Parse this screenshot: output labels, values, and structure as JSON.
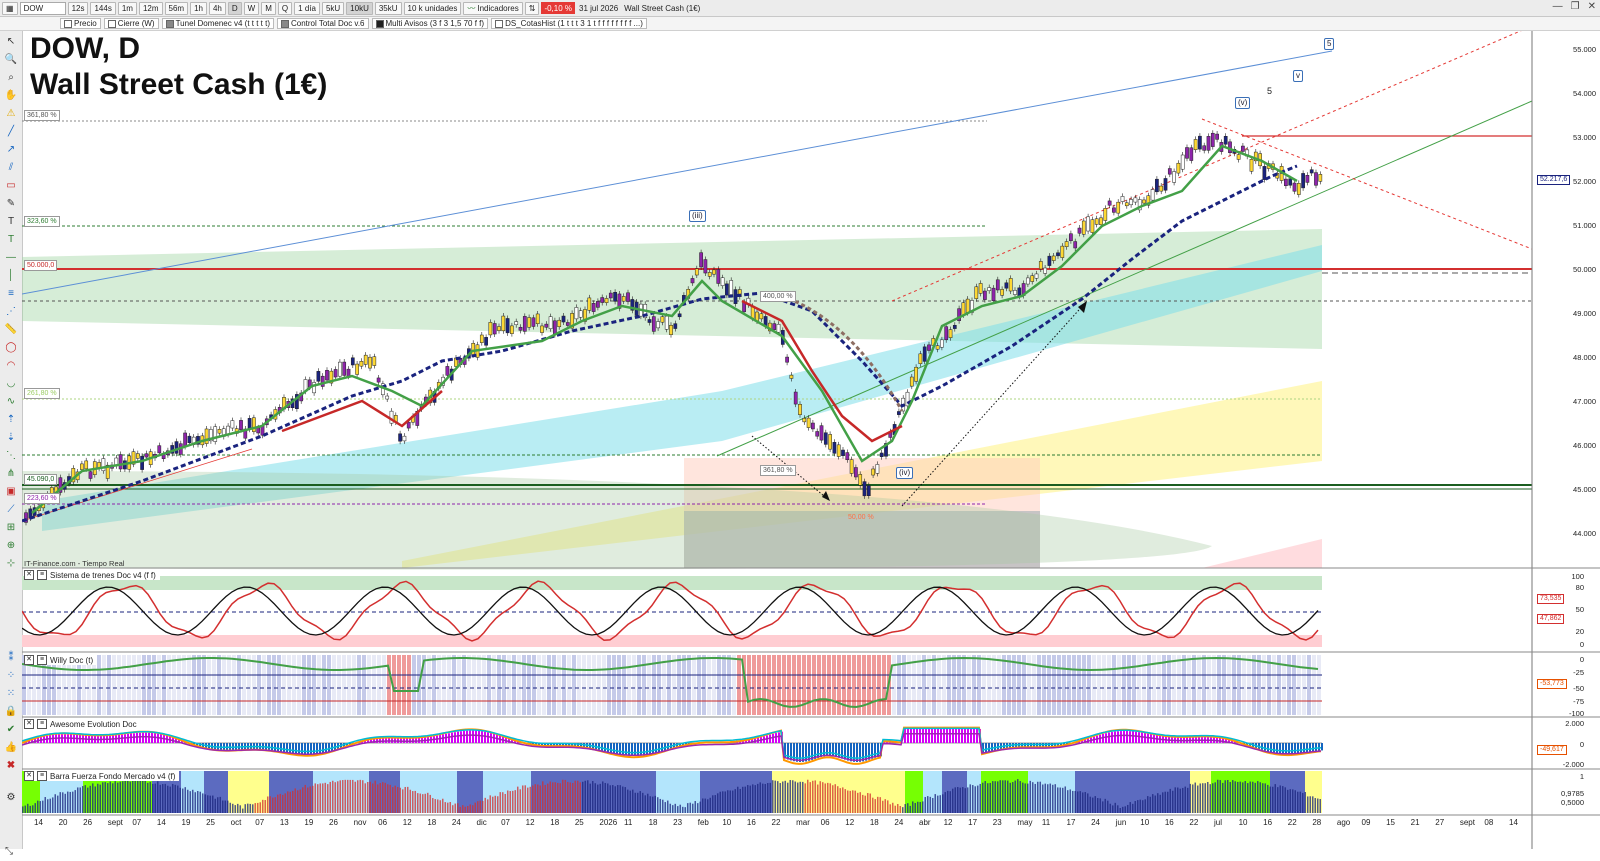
{
  "toolbar": {
    "symbol": "DOW",
    "intervals": [
      "12s",
      "144s",
      "1m",
      "12m",
      "56m",
      "1h",
      "4h",
      "D",
      "W",
      "M",
      "Q"
    ],
    "active_interval": "D",
    "period": "1 día",
    "units": [
      "5kU",
      "10kU",
      "35kU"
    ],
    "active_unit": "10kU",
    "units_select": "10 k unidades",
    "indicators_label": "Indicadores",
    "change_pct": "-0,10 %",
    "date_text": "31 jul 2026",
    "instrument_name": "Wall Street Cash (1€)"
  },
  "indicator_tabs": [
    "Precio",
    "Cierre (W)",
    "Tunel Domenec v4 (t t t t t)",
    "Control Total Doc v.6",
    "Multi Avisos (3 f 3 1,5 70 f f)",
    "DS_CotasHist (1 t t t 3 1 t f f f f f f f f ...)"
  ],
  "chart": {
    "title_line1": "DOW, D",
    "title_line2": "Wall Street Cash (1€)",
    "source": "IT-Finance.com - Tiempo Real",
    "price_axis": [
      "55.000",
      "54.000",
      "53.000",
      "52.000",
      "51.000",
      "50.000",
      "49.000",
      "48.000",
      "47.000",
      "46.000",
      "45.000",
      "44.000"
    ],
    "current_price": "52.217,6",
    "level_tags": [
      "361,80 %",
      "323,60 %",
      "50.000,0",
      "261,80 %",
      "45.090,0",
      "223,60 %"
    ],
    "fib_inner": [
      "400,00 %",
      "361,80 %",
      "50,00 %"
    ],
    "wave_labels": [
      "(iii)",
      "(iv)",
      "(v)",
      "5",
      "v",
      "5"
    ]
  },
  "panes": [
    {
      "name": "Sistema de trenes Doc v4 (f f)",
      "axis": [
        "100",
        "80",
        "50",
        "20",
        "0"
      ],
      "tags": [
        "73,535",
        "47,862"
      ]
    },
    {
      "name": "Willy Doc (t)",
      "axis": [
        "0",
        "-25",
        "-50",
        "-75",
        "-100"
      ],
      "tags": [
        "-53,773"
      ]
    },
    {
      "name": "Awesome Evolution Doc",
      "axis": [
        "2.000",
        "0",
        "-2.000"
      ],
      "tags": [
        "-49,617"
      ]
    },
    {
      "name": "Barra Fuerza Fondo Mercado v4 (f)",
      "axis": [
        "1",
        "0,9785",
        "0,5000"
      ],
      "tags": []
    }
  ],
  "x_axis": [
    "14",
    "20",
    "26",
    "sept",
    "07",
    "14",
    "19",
    "25",
    "oct",
    "07",
    "13",
    "19",
    "26",
    "nov",
    "06",
    "12",
    "18",
    "24",
    "dic",
    "07",
    "12",
    "18",
    "25",
    "2026",
    "11",
    "18",
    "23",
    "feb",
    "10",
    "16",
    "22",
    "mar",
    "06",
    "12",
    "18",
    "24",
    "abr",
    "12",
    "17",
    "23",
    "may",
    "11",
    "17",
    "24",
    "jun",
    "10",
    "16",
    "22",
    "jul",
    "10",
    "16",
    "22",
    "28",
    "ago",
    "09",
    "15",
    "21",
    "27",
    "sept",
    "08",
    "14"
  ]
}
